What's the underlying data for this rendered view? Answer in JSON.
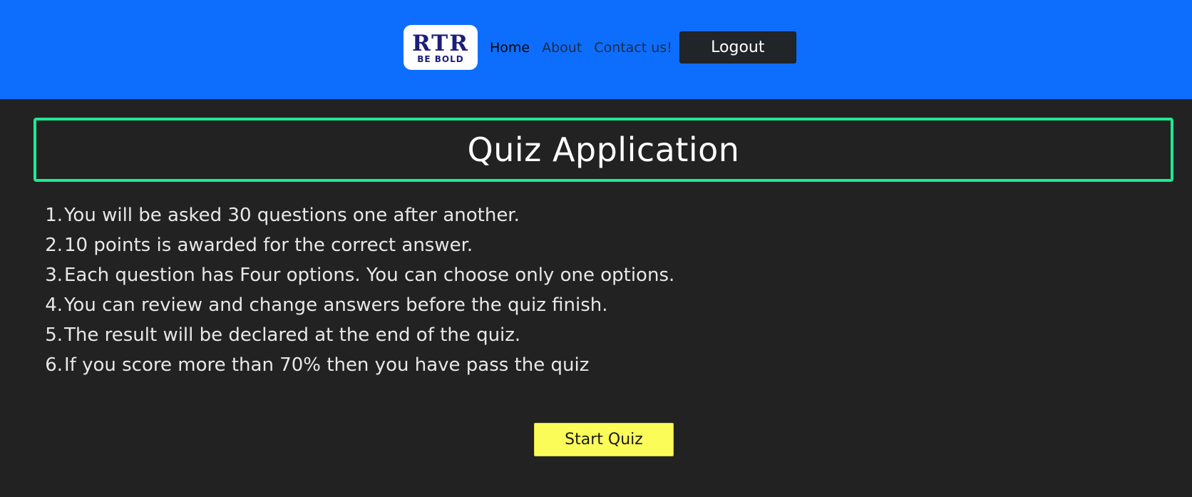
{
  "navbar": {
    "logo": {
      "main": "RTR",
      "tagline": "BE BOLD"
    },
    "links": [
      {
        "label": "Home",
        "active": true
      },
      {
        "label": "About",
        "active": false
      },
      {
        "label": "Contact us!",
        "active": false
      }
    ],
    "logout_label": "Logout"
  },
  "main": {
    "title": "Quiz Application",
    "rules": [
      {
        "num": "1.",
        "text": "You will be asked 30 questions one after another."
      },
      {
        "num": "2.",
        "text": "10 points is awarded for the correct answer."
      },
      {
        "num": "3.",
        "text": "Each question has Four options. You can choose only one options."
      },
      {
        "num": "4.",
        "text": "You can review and change answers before the quiz finish."
      },
      {
        "num": "5.",
        "text": "The result will be declared at the end of the quiz."
      },
      {
        "num": "6.",
        "text": "If you score more than 70% then you have pass the quiz"
      }
    ],
    "start_label": "Start Quiz"
  },
  "colors": {
    "navbar_bg": "#0d6efd",
    "page_bg": "#222222",
    "title_border": "#1fe994",
    "start_button_bg": "#fbfc58",
    "logout_button_bg": "#212529"
  }
}
